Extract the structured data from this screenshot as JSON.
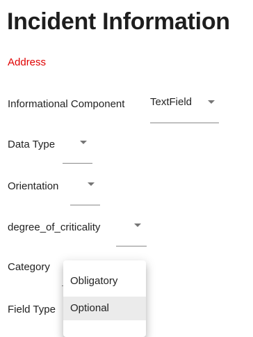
{
  "header": {
    "title": "Incident Information"
  },
  "section": {
    "label": "Address"
  },
  "fields": [
    {
      "label": "Informational Component",
      "value": "TextField"
    },
    {
      "label": "Data Type",
      "value": ""
    },
    {
      "label": "Orientation",
      "value": ""
    },
    {
      "label": "degree_of_criticality",
      "value": ""
    },
    {
      "label": "Category",
      "value": ""
    },
    {
      "label": "Field Type",
      "value": ""
    }
  ],
  "menu": {
    "options": [
      "Obligatory",
      "Optional"
    ],
    "highlighted": "Optional"
  },
  "colors": {
    "section": "#e00000",
    "menu_highlight": "#ebebeb"
  },
  "icons": {
    "dropdown": "triangle-down-icon"
  }
}
